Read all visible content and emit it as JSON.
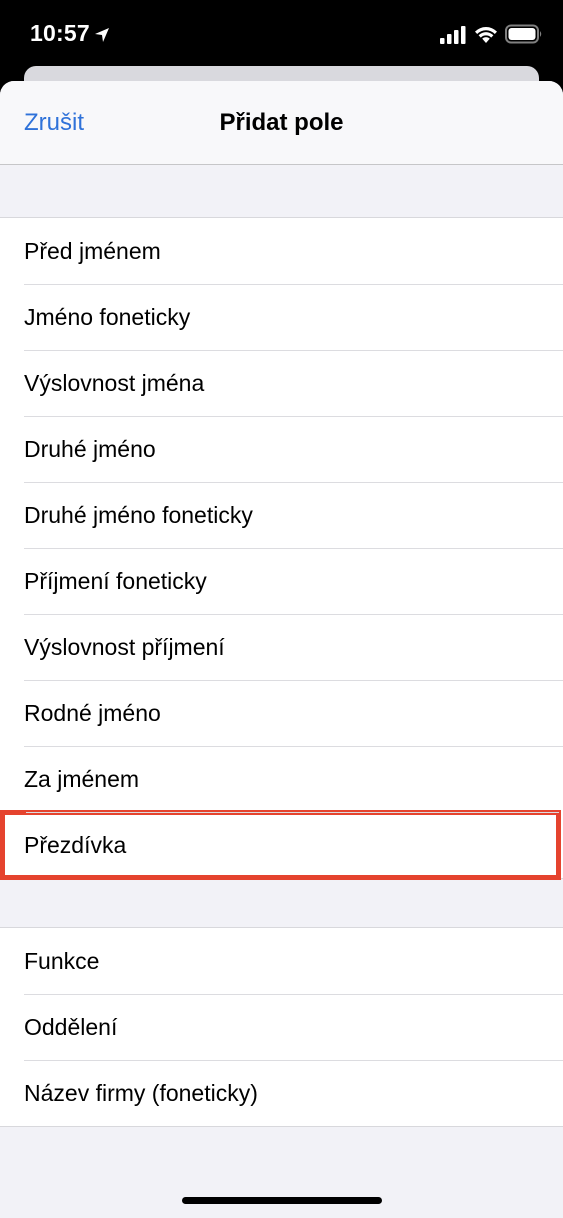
{
  "status_bar": {
    "time": "10:57",
    "icons": [
      "location-arrow-icon",
      "cellular-signal-icon",
      "wifi-icon",
      "battery-icon"
    ]
  },
  "nav": {
    "cancel_label": "Zrušit",
    "title": "Přidat pole"
  },
  "groups": [
    {
      "items": [
        {
          "label": "Před jménem"
        },
        {
          "label": "Jméno foneticky"
        },
        {
          "label": "Výslovnost jména"
        },
        {
          "label": "Druhé jméno"
        },
        {
          "label": "Druhé jméno foneticky"
        },
        {
          "label": "Příjmení foneticky"
        },
        {
          "label": "Výslovnost příjmení"
        },
        {
          "label": "Rodné jméno"
        },
        {
          "label": "Za jménem"
        },
        {
          "label": "Přezdívka",
          "highlighted": true
        }
      ]
    },
    {
      "items": [
        {
          "label": "Funkce"
        },
        {
          "label": "Oddělení"
        },
        {
          "label": "Název firmy (foneticky)"
        }
      ]
    }
  ],
  "colors": {
    "accent": "#2f72d9",
    "highlight": "#e5432e",
    "grouped_background": "#f2f2f7"
  }
}
